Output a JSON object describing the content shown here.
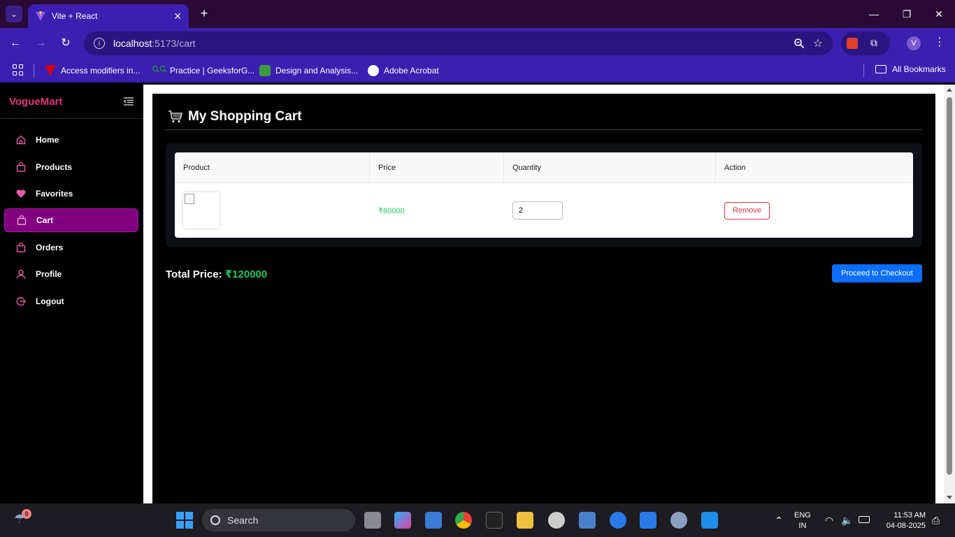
{
  "browser": {
    "tab_title": "Vite + React",
    "url_host": "localhost",
    "url_path": ":5173/cart",
    "profile_initial": "V",
    "bookmarks": [
      {
        "label": "Access modifiers in...",
        "color": "#d0021b"
      },
      {
        "label": "Practice | GeeksforG...",
        "color": "#2f8d46"
      },
      {
        "label": "Design and Analysis...",
        "color": "#3c9a3c"
      },
      {
        "label": "Adobe Acrobat",
        "color": "#ffffff"
      }
    ],
    "all_bookmarks": "All Bookmarks"
  },
  "sidebar": {
    "brand": "VogueMart",
    "brand_color": "#e0357a",
    "items": [
      {
        "label": "Home",
        "icon": "home-icon"
      },
      {
        "label": "Products",
        "icon": "bag-icon"
      },
      {
        "label": "Favorites",
        "icon": "heart-icon"
      },
      {
        "label": "Cart",
        "icon": "bag-icon",
        "active": true
      },
      {
        "label": "Orders",
        "icon": "bag-icon"
      },
      {
        "label": "Profile",
        "icon": "user-icon"
      },
      {
        "label": "Logout",
        "icon": "logout-icon"
      }
    ],
    "active_color": "#800080"
  },
  "cart": {
    "title": "My Shopping Cart",
    "columns": [
      "Product",
      "Price",
      "Quantity",
      "Action"
    ],
    "rows": [
      {
        "price": "₹60000",
        "quantity": "2",
        "action": "Remove"
      }
    ],
    "total_label": "Total Price:",
    "total_value": "₹120000",
    "checkout_label": "Proceed to Checkout"
  },
  "taskbar": {
    "search_label": "Search",
    "weather_badge": "8",
    "lang_line1": "ENG",
    "lang_line2": "IN",
    "time": "11:53 AM",
    "date": "04-08-2025"
  }
}
